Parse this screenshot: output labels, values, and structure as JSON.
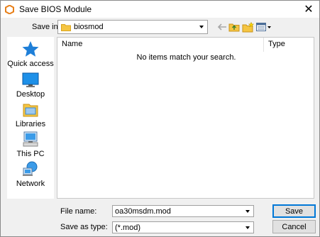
{
  "window": {
    "title": "Save BIOS Module",
    "close_glyph": "✕"
  },
  "toolbar": {
    "save_in_label": "Save in:",
    "save_in_value": "biosmod",
    "icons": [
      "back-arrow-icon",
      "up-folder-icon",
      "new-folder-icon",
      "view-menu-icon"
    ]
  },
  "places": [
    {
      "label": "Quick access",
      "icon": "quick-access-star-icon"
    },
    {
      "label": "Desktop",
      "icon": "desktop-icon"
    },
    {
      "label": "Libraries",
      "icon": "libraries-icon"
    },
    {
      "label": "This PC",
      "icon": "this-pc-icon"
    },
    {
      "label": "Network",
      "icon": "network-icon"
    }
  ],
  "file_list": {
    "columns": [
      "Name",
      "Type"
    ],
    "empty_message": "No items match your search."
  },
  "form": {
    "file_name_label": "File name:",
    "file_name_value": "oa30msdm.mod",
    "save_as_type_label": "Save as type:",
    "save_as_type_value": "(*.mod)"
  },
  "buttons": {
    "save": "Save",
    "cancel": "Cancel"
  },
  "colors": {
    "accent": "#0078d7",
    "star": "#1e7fd8",
    "folder": "#f5c542"
  }
}
